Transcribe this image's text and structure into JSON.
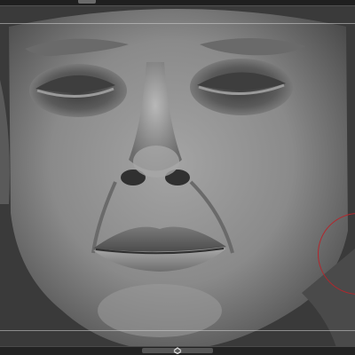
{
  "app": {
    "viewport": "3d-sculpt-viewport"
  },
  "scene": {
    "subject": "sculpted-face-model",
    "background_color": "#3a3a3a",
    "skin_color": "#8a8a8a"
  },
  "brush": {
    "cursor_color": "#b3262c"
  },
  "icons": {
    "expand_toggle": "chevron-up-down-icon"
  }
}
